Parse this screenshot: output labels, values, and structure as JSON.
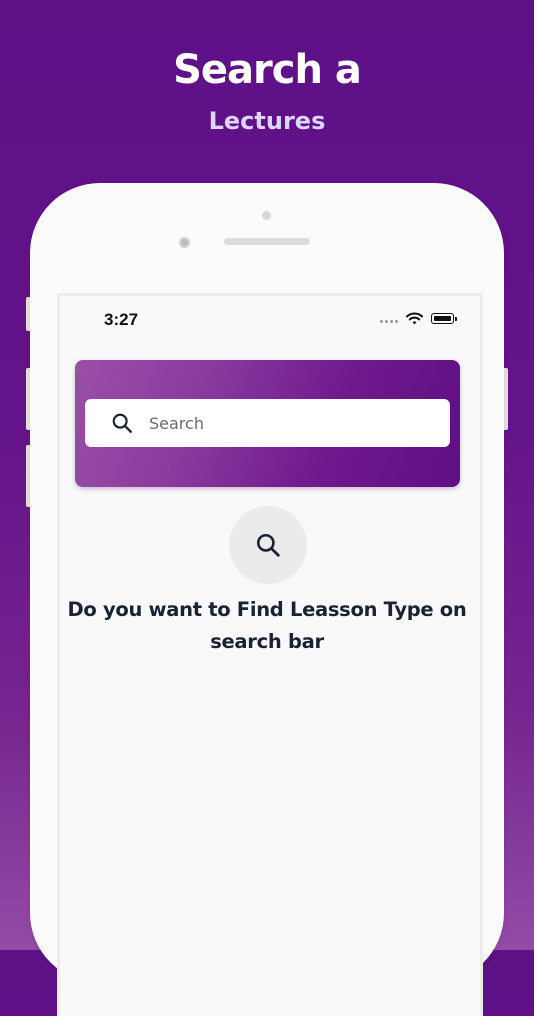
{
  "promo": {
    "headline": "Search a",
    "subline": "Lectures"
  },
  "status_bar": {
    "time": "3:27",
    "icons": [
      "cellular-dots-icon",
      "wifi-icon",
      "battery-icon"
    ]
  },
  "search": {
    "placeholder": "Search",
    "value": "",
    "icon": "search-icon"
  },
  "empty_state": {
    "icon": "search-icon",
    "message": "Do you want to Find Leasson Type on search bar"
  },
  "colors": {
    "background_top": "#5e1087",
    "background_bottom": "#934ba6",
    "card_gradient_start": "#9a4fa7",
    "card_gradient_end": "#5f0e85",
    "text_dark": "#1a2236"
  }
}
